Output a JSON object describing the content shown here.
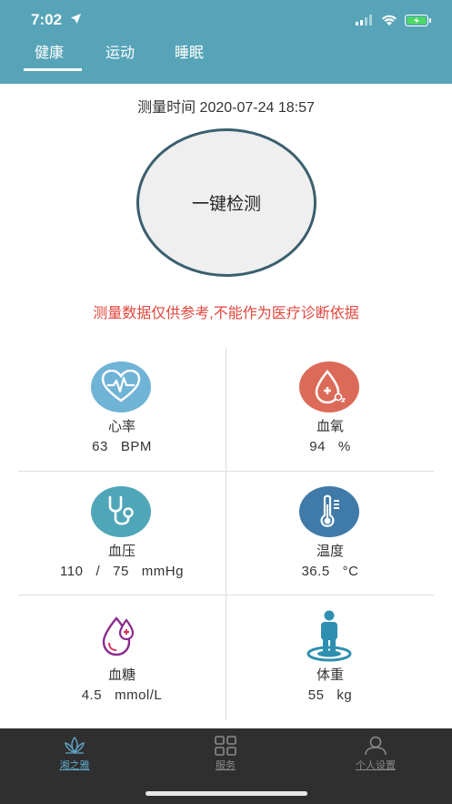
{
  "status_bar": {
    "time": "7:02"
  },
  "tabs": [
    {
      "label": "健康",
      "active": true
    },
    {
      "label": "运动",
      "active": false
    },
    {
      "label": "睡眠",
      "active": false
    }
  ],
  "measure": {
    "time_label": "测量时间 2020-07-24 18:57",
    "detect_button": "一键检测",
    "disclaimer": "测量数据仅供参考,不能作为医疗诊断依据"
  },
  "metrics": {
    "heart_rate": {
      "name": "心率",
      "value": "63",
      "unit": "BPM",
      "color": "#6fb3d6"
    },
    "blood_oxygen": {
      "name": "血氧",
      "value": "94",
      "unit": "%",
      "color": "#dc6a58"
    },
    "blood_pressure": {
      "name": "血压",
      "systolic": "110",
      "sep": "/",
      "diastolic": "75",
      "unit": "mmHg",
      "color": "#4fa6b8"
    },
    "temperature": {
      "name": "温度",
      "value": "36.5",
      "unit": "°C",
      "color": "#3f7aa9"
    },
    "blood_sugar": {
      "name": "血糖",
      "value": "4.5",
      "unit": "mmol/L",
      "color": "#8b2a8e"
    },
    "weight": {
      "name": "体重",
      "value": "55",
      "unit": "kg",
      "color": "#2f8fb0"
    }
  },
  "bottom_nav": [
    {
      "label": "湘之雅",
      "icon": "lotus-icon",
      "active": true
    },
    {
      "label": "服务",
      "icon": "grid-icon",
      "active": false
    },
    {
      "label": "个人设置",
      "icon": "person-icon",
      "active": false
    }
  ],
  "colors": {
    "header": "#57a4b8",
    "disclaimer": "#e0463c",
    "bottom_bar": "#2f2f2f",
    "active_nav": "#5fa7c9"
  }
}
